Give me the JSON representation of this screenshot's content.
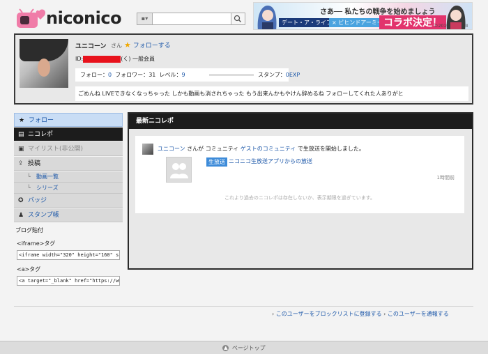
{
  "header": {
    "logo_text": "niconico",
    "search_category_icon": "tv-icon",
    "search_placeholder": "",
    "banner": {
      "line1": "さあ── 私たちの戦争を始めましょう",
      "line2": "デート・ア・ライブⅢ",
      "line3": "× ビヒンドアーミー",
      "line4": "コラボ決定！",
      "copyright": "©2019 ・DAL III"
    }
  },
  "profile": {
    "name": "ユニコーン",
    "honorific": "さん",
    "follow_label": "フォローする",
    "id_label": "ID:",
    "id_suffix": "(く) 一般会員",
    "stats": {
      "follow_label": "フォロー：",
      "follow_value": "0",
      "follower_label": "フォロワー：",
      "follower_value": "31",
      "level_label": "レベル：",
      "level_value": "9",
      "level_progress": 0,
      "stamp_label": "スタンプ：",
      "stamp_value": "0EXP"
    },
    "bio": "ごめんね LIVEできなくなっちゃった しかも動画も消されちゃった もう出来んかもやけん辞めるね フォローしてくれた人ありがと"
  },
  "sidebar": {
    "items": [
      {
        "label": "フォロー",
        "icon": "star-icon"
      },
      {
        "label": "ニコレポ",
        "icon": "document-icon"
      },
      {
        "label": "マイリスト(非公開)",
        "icon": "bookmark-icon"
      },
      {
        "label": "投稿",
        "icon": "upload-icon"
      },
      {
        "label": "動画一覧",
        "icon": "corner-icon"
      },
      {
        "label": "シリーズ",
        "icon": "corner-icon"
      },
      {
        "label": "バッジ",
        "icon": "badge-icon"
      },
      {
        "label": "スタンプ帳",
        "icon": "stamp-icon"
      }
    ],
    "blog": {
      "title": "ブログ貼付",
      "iframe_label": "<iframe>タグ",
      "iframe_code": "<iframe width=\"320\" height=\"160\" src",
      "a_label": "<a>タグ",
      "a_code": "<a target=\"_blank\" href=\"https://www."
    }
  },
  "main": {
    "title": "最新ニコレポ",
    "report": {
      "user": "ユニコーン",
      "t1": " さんが ",
      "community_label": "コミュニティ",
      "community_name": "ゲストのコミュニティ",
      "t2": " で生放送を開始しました。",
      "badge": "生放送",
      "app_link": "ニコニコ生放送アプリからの放送",
      "time": "1時間前"
    },
    "note": "これより過去のニコレポは存在しないか、表示期限を過ぎています。"
  },
  "footer": {
    "link_block": "このユーザーをブロックリストに登録する",
    "link_report": "このユーザーを通報する",
    "arrow": "›",
    "pagetop": "ページトップ",
    "pagetop_icon": "up-arrow-icon"
  },
  "colors": {
    "accent_blue": "#1a56a8",
    "badge_blue": "#3d8bd9",
    "redaction": "#e8121c",
    "active_nav": "#1c1c1c"
  }
}
